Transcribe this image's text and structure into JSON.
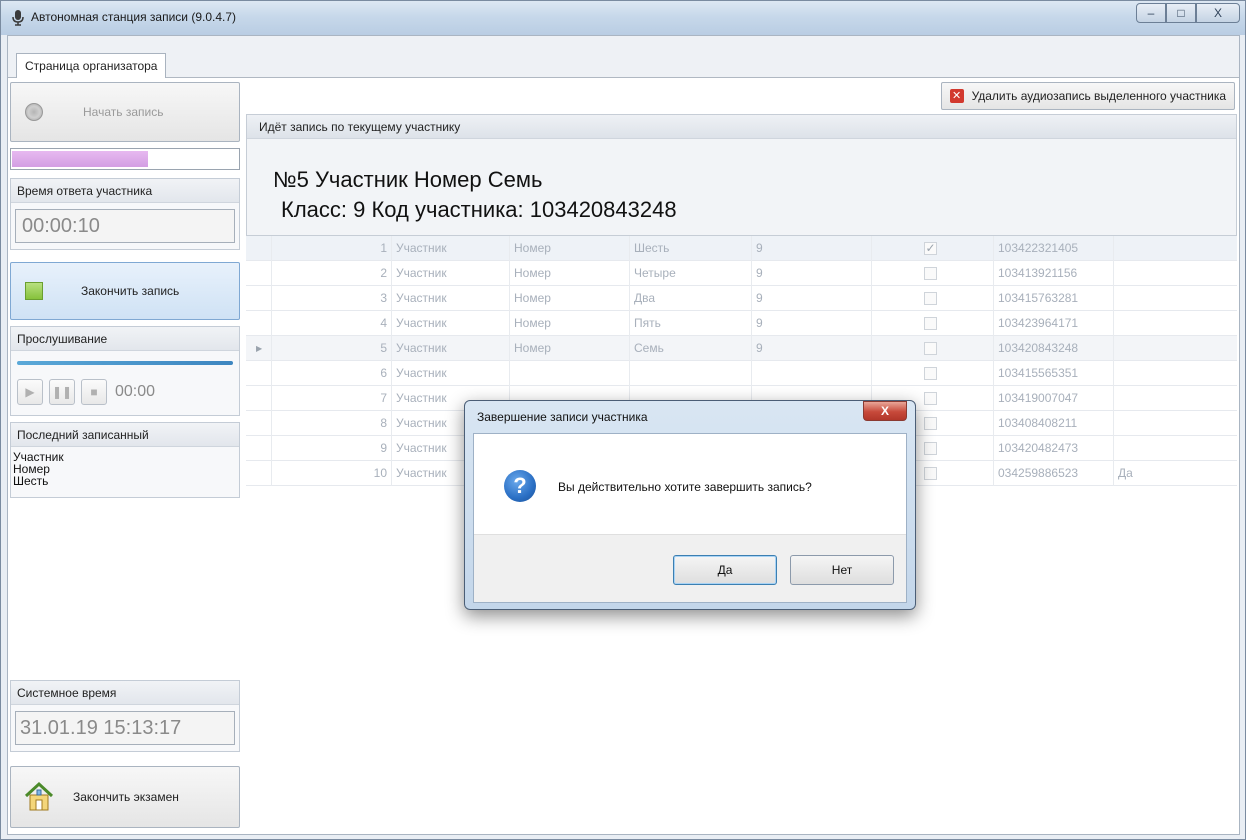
{
  "window": {
    "title": "Автономная станция записи (9.0.4.7)",
    "controls": {
      "minimize": "–",
      "maximize": "□",
      "close": "X"
    }
  },
  "tabs": [
    "Страница организатора"
  ],
  "left": {
    "start_record": "Начать запись",
    "answer_time_label": "Время ответа участника",
    "answer_time": "00:00:10",
    "stop_record": "Закончить запись",
    "listen_label": "Прослушивание",
    "listen_time": "00:00",
    "last_label": "Последний записанный",
    "last_lines": [
      "Участник",
      "Номер",
      "Шесть"
    ],
    "systime_label": "Системное время",
    "systime": "31.01.19 15:13:17",
    "end_exam": "Закончить экзамен",
    "record_progress_fraction": 0.6
  },
  "right": {
    "delete_button": "Удалить аудиозапись выделенного участника",
    "current_header": "Идёт запись по текущему участнику",
    "current_name": "№5 Участник Номер Семь",
    "current_class": "Класс: 9 Код участника: 103420843248"
  },
  "grid": {
    "rows": [
      {
        "n": "1",
        "last": "Участник",
        "first": "Номер",
        "middle": "Шесть",
        "cls": "9",
        "checked": "✓",
        "code": "103422321405",
        "extra": ""
      },
      {
        "n": "2",
        "last": "Участник",
        "first": "Номер",
        "middle": "Четыре",
        "cls": "9",
        "checked": "",
        "code": "103413921156",
        "extra": ""
      },
      {
        "n": "3",
        "last": "Участник",
        "first": "Номер",
        "middle": "Два",
        "cls": "9",
        "checked": "",
        "code": "103415763281",
        "extra": ""
      },
      {
        "n": "4",
        "last": "Участник",
        "first": "Номер",
        "middle": "Пять",
        "cls": "9",
        "checked": "",
        "code": "103423964171",
        "extra": ""
      },
      {
        "n": "5",
        "last": "Участник",
        "first": "Номер",
        "middle": "Семь",
        "cls": "9",
        "checked": "",
        "code": "103420843248",
        "extra": ""
      },
      {
        "n": "6",
        "last": "Участник",
        "first": "",
        "middle": "",
        "cls": "",
        "checked": "",
        "code": "103415565351",
        "extra": ""
      },
      {
        "n": "7",
        "last": "Участник",
        "first": "",
        "middle": "",
        "cls": "",
        "checked": "",
        "code": "103419007047",
        "extra": ""
      },
      {
        "n": "8",
        "last": "Участник",
        "first": "",
        "middle": "",
        "cls": "",
        "checked": "",
        "code": "103408408211",
        "extra": ""
      },
      {
        "n": "9",
        "last": "Участник",
        "first": "",
        "middle": "",
        "cls": "",
        "checked": "",
        "code": "103420482473",
        "extra": ""
      },
      {
        "n": "10",
        "last": "Участник",
        "first": "",
        "middle": "",
        "cls": "",
        "checked": "",
        "code": "034259886523",
        "extra": "Да"
      }
    ]
  },
  "dialog": {
    "title": "Завершение записи участника",
    "close": "X",
    "message": "Вы действительно хотите завершить запись?",
    "icon": "?",
    "yes": "Да",
    "no": "Нет"
  }
}
